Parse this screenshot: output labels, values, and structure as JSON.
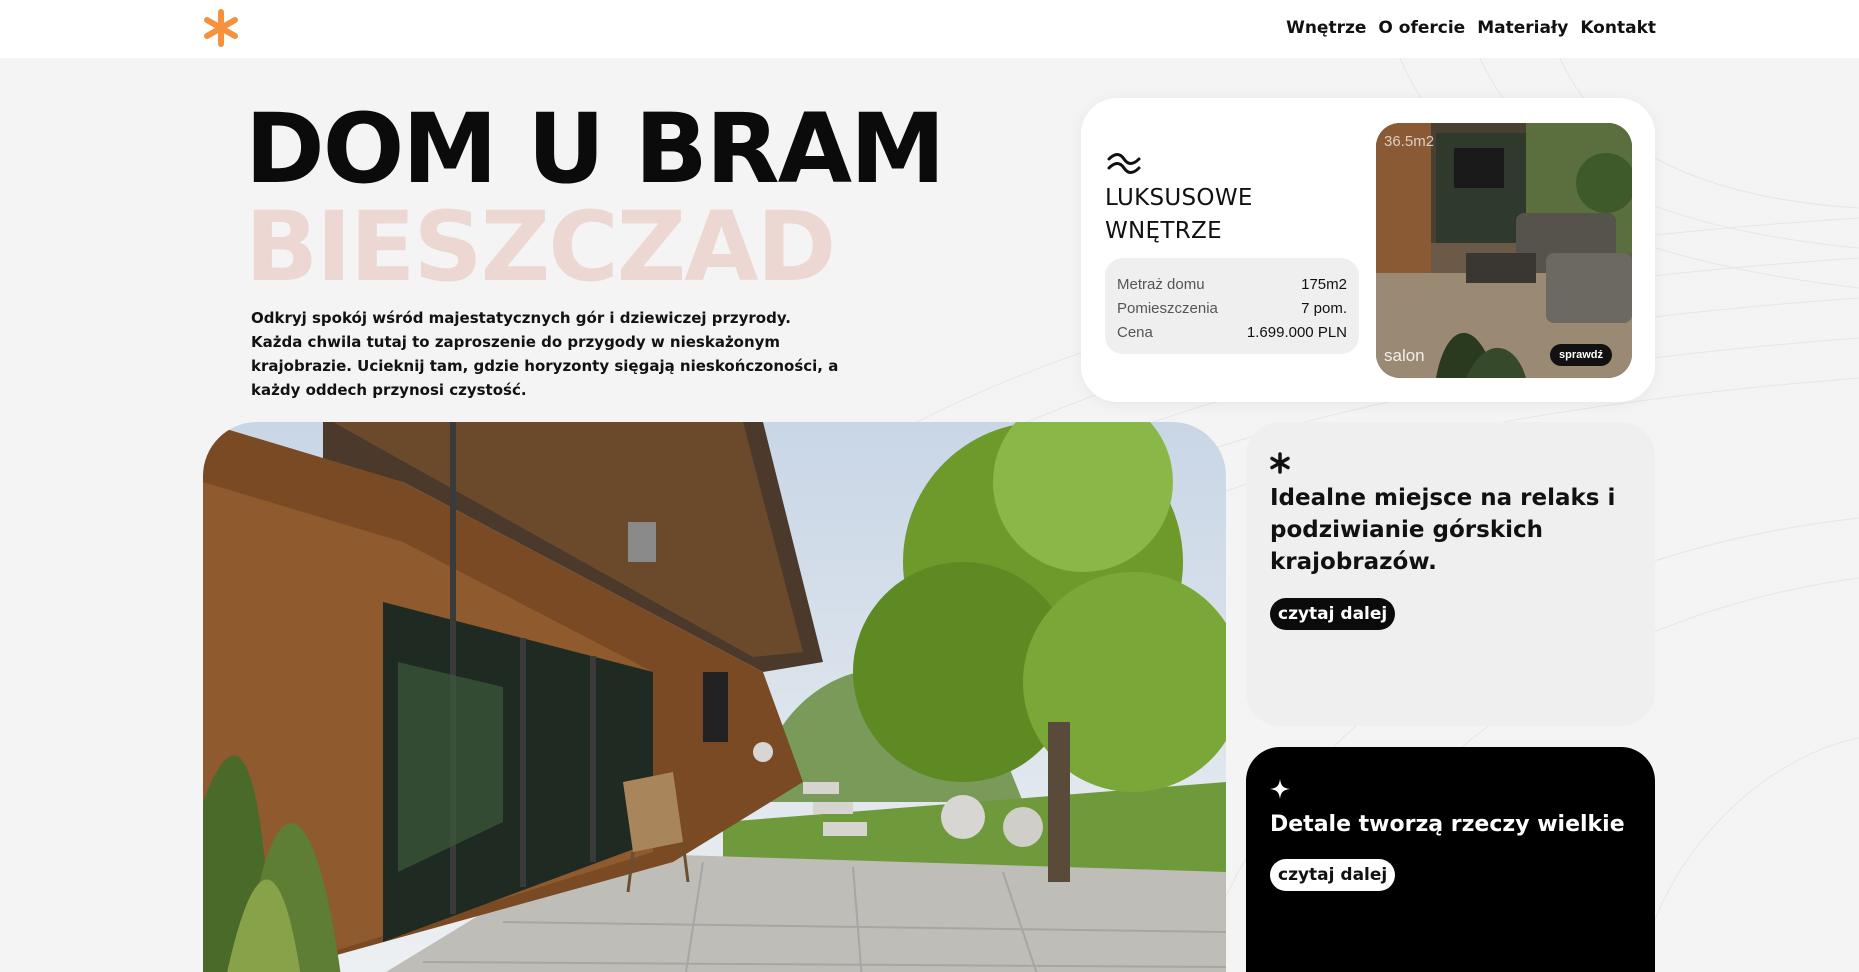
{
  "nav": {
    "items": [
      "Wnętrze",
      "O ofercie",
      "Materiały",
      "Kontakt"
    ]
  },
  "hero": {
    "title_line1": "DOM U BRAM",
    "title_line2": "BIESZCZAD",
    "description": "Odkryj spokój wśród majestatycznych gór i dziewiczej przyrody. Każda chwila tutaj to zaproszenie do przygody w nieskażonym krajobrazie. Ucieknij tam, gdzie horyzonty sięgają nieskończoności, a każdy oddech przynosi czystość."
  },
  "info_card": {
    "title": "LUKSUSOWE WNĘTRZE",
    "specs": [
      {
        "label": "Metraż domu",
        "value": "175m2"
      },
      {
        "label": "Pomieszczenia",
        "value": "7 pom."
      },
      {
        "label": "Cena",
        "value": "1.699.000 PLN"
      }
    ],
    "room_area": "36.5m2",
    "room_name": "salon",
    "room_button": "sprawdź"
  },
  "feature_card": {
    "text": "Idealne miejsce na relaks i podziwianie górskich krajobrazów.",
    "button": "czytaj dalej"
  },
  "dark_card": {
    "text": "Detale tworzą rzeczy wielkie",
    "button": "czytaj dalej"
  },
  "colors": {
    "accent": "#f7913d",
    "title_pink": "#ecd7d3",
    "dark": "#000000"
  },
  "icons": {
    "logo": "asterisk-logo-icon",
    "info_card": "wave-icon",
    "feature_card": "asterisk-icon",
    "dark_card": "sparkle-icon"
  }
}
